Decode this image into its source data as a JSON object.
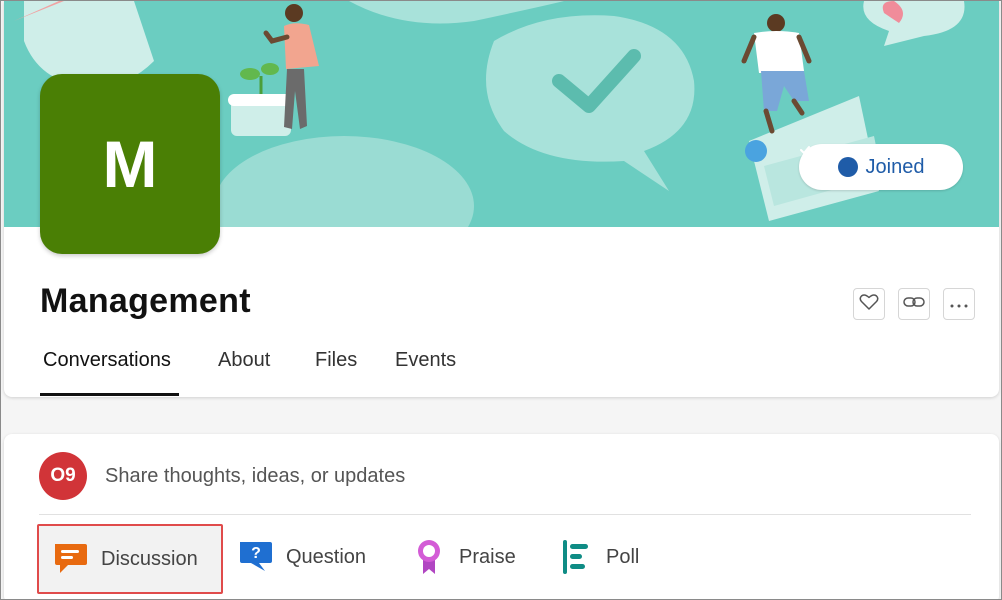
{
  "group": {
    "initial": "M",
    "name": "Management",
    "avatar_color": "#4a7f05",
    "cover_color": "#6bcdc1",
    "joined_label": "Joined"
  },
  "header_actions": [
    {
      "icon": "heart-icon",
      "label": ""
    },
    {
      "icon": "link-icon",
      "label": ""
    },
    {
      "icon": "more-icon",
      "label": ""
    }
  ],
  "tabs": [
    {
      "label": "Conversations",
      "active": true
    },
    {
      "label": "About",
      "active": false
    },
    {
      "label": "Files",
      "active": false
    },
    {
      "label": "Events",
      "active": false
    }
  ],
  "composer": {
    "user_initials": "O9",
    "user_avatar_color": "#d13438",
    "placeholder": "Share thoughts, ideas, or updates"
  },
  "post_types": [
    {
      "label": "Discussion",
      "icon": "discussion-icon",
      "selected": true
    },
    {
      "label": "Question",
      "icon": "question-icon",
      "selected": false
    },
    {
      "label": "Praise",
      "icon": "praise-icon",
      "selected": false
    },
    {
      "label": "Poll",
      "icon": "poll-icon",
      "selected": false
    }
  ],
  "colors": {
    "accent_blue": "#1f5ca8",
    "selection_outline": "#e04b4b"
  }
}
